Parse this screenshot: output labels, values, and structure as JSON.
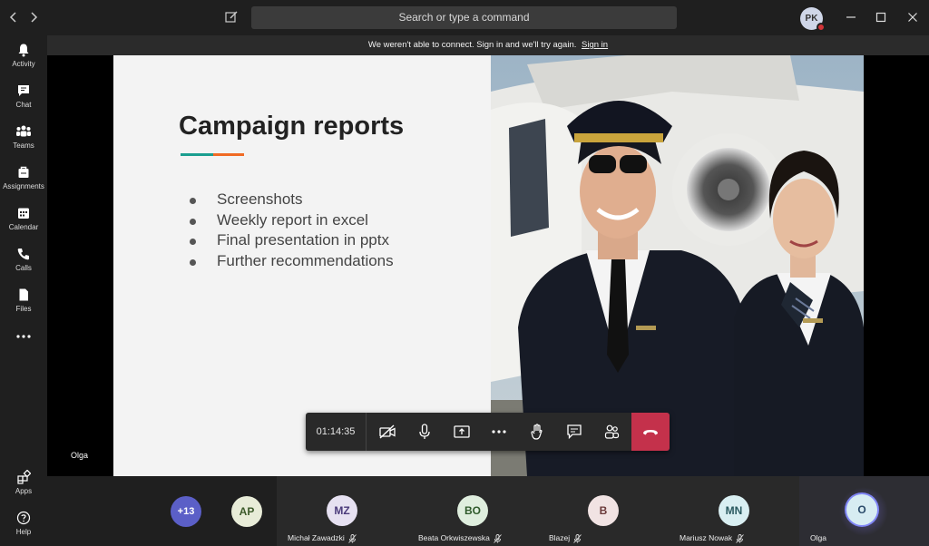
{
  "titlebar": {
    "search_placeholder": "Search or type a command",
    "user_initials": "PK"
  },
  "rail": {
    "items": [
      {
        "label": "Activity"
      },
      {
        "label": "Chat"
      },
      {
        "label": "Teams"
      },
      {
        "label": "Assignments"
      },
      {
        "label": "Calendar"
      },
      {
        "label": "Calls"
      },
      {
        "label": "Files"
      }
    ],
    "bottom": [
      {
        "label": "Apps"
      },
      {
        "label": "Help"
      }
    ]
  },
  "banner": {
    "text": "We weren't able to connect. Sign in and we'll try again.",
    "link": "Sign in"
  },
  "slide": {
    "title": "Campaign reports",
    "bullets": [
      "Screenshots",
      "Weekly report in excel",
      "Final presentation in pptx",
      "Further recommendations"
    ],
    "accent_colors": [
      "#1a9e8f",
      "#f06a24"
    ]
  },
  "stage": {
    "presenter_name": "Olga"
  },
  "controls": {
    "timer": "01:14:35"
  },
  "participants": {
    "overflow_count": "+13",
    "list": [
      {
        "initials": "AP",
        "name": "",
        "bg": "#e8ecd8",
        "fg": "#3c5a2a"
      },
      {
        "initials": "MZ",
        "name": "Michał Zawadzki",
        "bg": "#e6e1f1",
        "fg": "#4a3a7a"
      },
      {
        "initials": "BO",
        "name": "Beata Orkwiszewska",
        "bg": "#dfeede",
        "fg": "#2f5a2b"
      },
      {
        "initials": "B",
        "name": "Blazej",
        "bg": "#f1e3e3",
        "fg": "#6a3a3a"
      },
      {
        "initials": "MN",
        "name": "Mariusz Nowak",
        "bg": "#d9eff2",
        "fg": "#2a5a60"
      },
      {
        "initials": "O",
        "name": "Olga",
        "bg": "#d7ecf2",
        "fg": "#2a4a6a"
      }
    ]
  }
}
